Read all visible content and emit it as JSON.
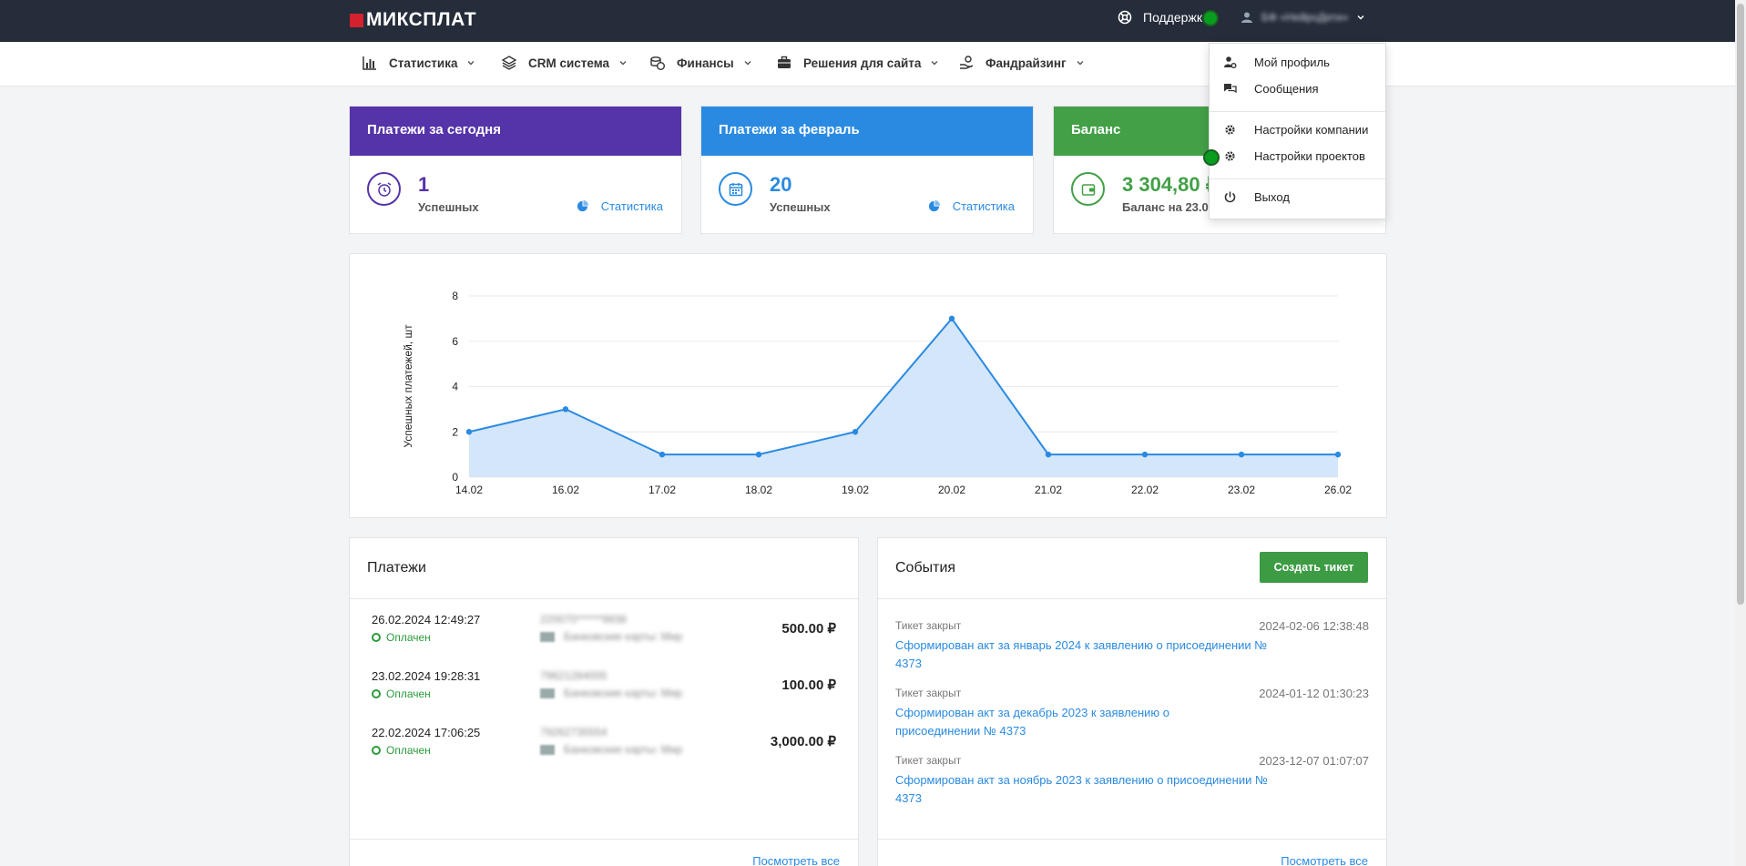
{
  "header": {
    "logo_text": "МИКСПЛАТ",
    "support_label": "Поддержк",
    "user_name": "БФ «НейроДети»"
  },
  "nav": {
    "items": [
      {
        "label": "Статистика",
        "icon": "bar-chart-icon"
      },
      {
        "label": "CRM система",
        "icon": "layers-icon"
      },
      {
        "label": "Финансы",
        "icon": "coins-icon"
      },
      {
        "label": "Решения для сайта",
        "icon": "briefcase-icon"
      },
      {
        "label": "Фандрайзинг",
        "icon": "hand-coin-icon"
      }
    ]
  },
  "cards": {
    "today": {
      "title": "Платежи за сегодня",
      "value": "1",
      "sub": "Успешных",
      "link": "Статистика",
      "color": "#5533a8"
    },
    "month": {
      "title": "Платежи за февраль",
      "value": "20",
      "sub": "Успешных",
      "link": "Статистика",
      "color": "#2a8ae2"
    },
    "balance": {
      "title": "Баланс",
      "value": "3 304,80 ₽",
      "sub": "Баланс на 23.02",
      "color": "#43a047"
    }
  },
  "chart_data": {
    "type": "area",
    "x": [
      "14.02",
      "16.02",
      "17.02",
      "18.02",
      "19.02",
      "20.02",
      "21.02",
      "22.02",
      "23.02",
      "26.02"
    ],
    "values": [
      2,
      3,
      1,
      1,
      2,
      7,
      1,
      1,
      1,
      1
    ],
    "ylabel": "Успешных платежей, шт",
    "ylim": [
      0,
      8
    ],
    "yticks": [
      "0",
      "2",
      "4",
      "6",
      "8"
    ],
    "grid": true,
    "colors": {
      "line": "#2a8ae2",
      "fill": "#cfe3f8"
    }
  },
  "payments": {
    "title": "Платежи",
    "rows": [
      {
        "date": "26.02.2024 12:49:27",
        "status": "Оплачен",
        "masked": "220070******9938",
        "method": "Банковские карты: Мир",
        "amount": "500.00 ₽"
      },
      {
        "date": "23.02.2024 19:28:31",
        "status": "Оплачен",
        "masked": "79621284005",
        "method": "Банковские карты: Мир",
        "amount": "100.00 ₽"
      },
      {
        "date": "22.02.2024 17:06:25",
        "status": "Оплачен",
        "masked": "79262735554",
        "method": "Банковские карты: Мир",
        "amount": "3,000.00 ₽"
      }
    ],
    "view_all": "Посмотреть все"
  },
  "events": {
    "title": "События",
    "create_button": "Создать тикет",
    "rows": [
      {
        "status": "Тикет закрыт",
        "date": "2024-02-06 12:38:48",
        "text": "Сформирован акт за январь 2024 к заявлению о присоединении № 4373"
      },
      {
        "status": "Тикет закрыт",
        "date": "2024-01-12 01:30:23",
        "text": "Сформирован акт за декабрь 2023 к заявлению о присоединении № 4373"
      },
      {
        "status": "Тикет закрыт",
        "date": "2023-12-07 01:07:07",
        "text": "Сформирован акт за ноябрь 2023 к заявлению о присоединении № 4373"
      }
    ],
    "view_all": "Посмотреть все"
  },
  "user_menu": {
    "profile": "Мой профиль",
    "messages": "Сообщения",
    "company_settings": "Настройки компании",
    "project_settings": "Настройки проектов",
    "logout": "Выход"
  }
}
